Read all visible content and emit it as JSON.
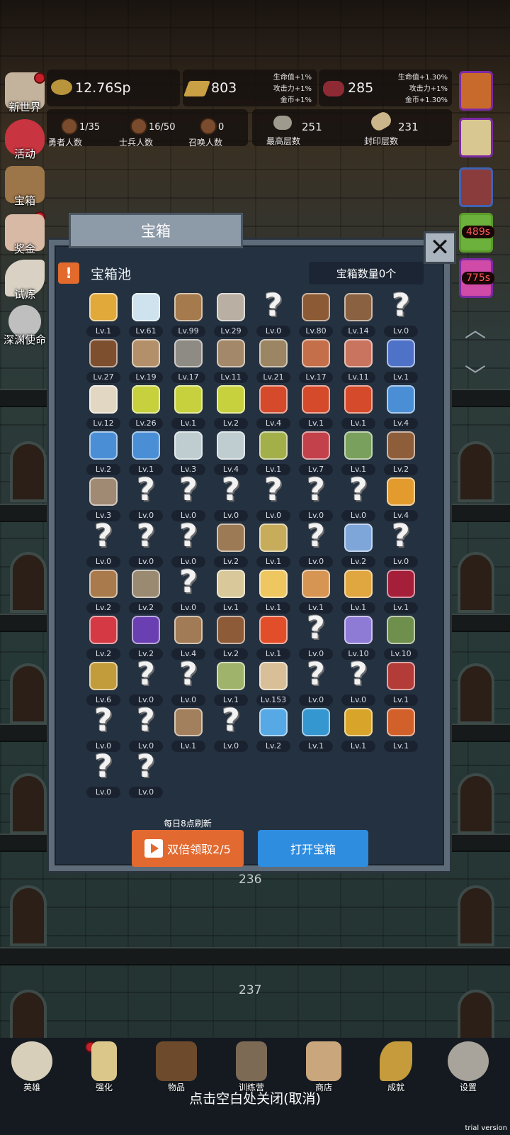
{
  "resources": {
    "coins": "12.76Sp",
    "gold_bar": "803",
    "gold_bar_bonus": [
      "生命值+1%",
      "攻击力+1%",
      "金币+1%"
    ],
    "meat": "285",
    "meat_bonus": [
      "生命值+1.30%",
      "攻击力+1%",
      "金币+1.30%"
    ]
  },
  "counts": {
    "heroes_value": "1/35",
    "heroes_label": "勇者人数",
    "soldiers_value": "16/50",
    "soldiers_label": "士兵人数",
    "summons_value": "0",
    "summons_label": "召唤人数",
    "max_floor_value": "251",
    "max_floor_label": "最高层数",
    "sealed_floor_value": "231",
    "sealed_floor_label": "封印层数"
  },
  "side_menu": [
    "新世界",
    "活动",
    "宝箱",
    "奖金",
    "试炼",
    "深渊使命"
  ],
  "timers": [
    "489s",
    "775s"
  ],
  "floors": [
    "236",
    "237"
  ],
  "modal": {
    "title": "宝箱",
    "pool_title": "宝箱池",
    "chest_count": "宝箱数量0个",
    "refresh_note": "每日8点刷新",
    "double_button": "双倍领取2/5",
    "open_button": "打开宝箱"
  },
  "items": [
    {
      "icon": "crown-icon",
      "level": "Lv.1"
    },
    {
      "icon": "diamond-icon",
      "level": "Lv.61"
    },
    {
      "icon": "wooden-sword-icon",
      "level": "Lv.99"
    },
    {
      "icon": "iron-sword-icon",
      "level": "Lv.29"
    },
    {
      "icon": "unknown-icon",
      "level": "Lv.0"
    },
    {
      "icon": "leather-armor-icon",
      "level": "Lv.80"
    },
    {
      "icon": "backpack-icon",
      "level": "Lv.14"
    },
    {
      "icon": "unknown-icon",
      "level": "Lv.0"
    },
    {
      "icon": "leather-helmet-icon",
      "level": "Lv.27"
    },
    {
      "icon": "dagger-icon",
      "level": "Lv.19"
    },
    {
      "icon": "knight-helmet-icon",
      "level": "Lv.17"
    },
    {
      "icon": "hammer-icon",
      "level": "Lv.11"
    },
    {
      "icon": "great-helm-icon",
      "level": "Lv.21"
    },
    {
      "icon": "drumstick-icon",
      "level": "Lv.17"
    },
    {
      "icon": "steak-icon",
      "level": "Lv.11"
    },
    {
      "icon": "blue-bag-icon",
      "level": "Lv.1"
    },
    {
      "icon": "flour-sack-icon",
      "level": "Lv.12"
    },
    {
      "icon": "yellow-potion-icon",
      "level": "Lv.26"
    },
    {
      "icon": "yellow-potion-icon",
      "level": "Lv.1"
    },
    {
      "icon": "yellow-potion-icon",
      "level": "Lv.2"
    },
    {
      "icon": "red-potion-icon",
      "level": "Lv.4"
    },
    {
      "icon": "red-potion-icon",
      "level": "Lv.1"
    },
    {
      "icon": "red-potion-icon",
      "level": "Lv.1"
    },
    {
      "icon": "blue-potion-icon",
      "level": "Lv.4"
    },
    {
      "icon": "blue-potion-icon",
      "level": "Lv.2"
    },
    {
      "icon": "blue-potion-icon",
      "level": "Lv.1"
    },
    {
      "icon": "empty-vial-icon",
      "level": "Lv.3"
    },
    {
      "icon": "empty-vial-icon",
      "level": "Lv.4"
    },
    {
      "icon": "green-bottle-icon",
      "level": "Lv.1"
    },
    {
      "icon": "red-bottle-icon",
      "level": "Lv.7"
    },
    {
      "icon": "winged-boot-icon",
      "level": "Lv.1"
    },
    {
      "icon": "boot-icon",
      "level": "Lv.2"
    },
    {
      "icon": "cloth-boot-icon",
      "level": "Lv.3"
    },
    {
      "icon": "unknown-icon",
      "level": "Lv.0"
    },
    {
      "icon": "unknown-icon",
      "level": "Lv.0"
    },
    {
      "icon": "unknown-icon",
      "level": "Lv.0"
    },
    {
      "icon": "unknown-icon",
      "level": "Lv.0"
    },
    {
      "icon": "unknown-icon",
      "level": "Lv.0"
    },
    {
      "icon": "unknown-icon",
      "level": "Lv.0"
    },
    {
      "icon": "torch-icon",
      "level": "Lv.4"
    },
    {
      "icon": "unknown-icon",
      "level": "Lv.0"
    },
    {
      "icon": "unknown-icon",
      "level": "Lv.0"
    },
    {
      "icon": "unknown-icon",
      "level": "Lv.0"
    },
    {
      "icon": "wooden-staff-icon",
      "level": "Lv.2"
    },
    {
      "icon": "potato-icon",
      "level": "Lv.1"
    },
    {
      "icon": "unknown-icon",
      "level": "Lv.0"
    },
    {
      "icon": "blue-wand-icon",
      "level": "Lv.2"
    },
    {
      "icon": "unknown-icon",
      "level": "Lv.0"
    },
    {
      "icon": "leather-bag-icon",
      "level": "Lv.2"
    },
    {
      "icon": "shovel-icon",
      "level": "Lv.2"
    },
    {
      "icon": "unknown-icon",
      "level": "Lv.0"
    },
    {
      "icon": "bone-club-icon",
      "level": "Lv.1"
    },
    {
      "icon": "cheese-icon",
      "level": "Lv.1"
    },
    {
      "icon": "pie-icon",
      "level": "Lv.1"
    },
    {
      "icon": "honey-jar-icon",
      "level": "Lv.1"
    },
    {
      "icon": "red-crystal-icon",
      "level": "Lv.1"
    },
    {
      "icon": "red-orb-icon",
      "level": "Lv.2"
    },
    {
      "icon": "magic-cube-icon",
      "level": "Lv.2"
    },
    {
      "icon": "bow-icon",
      "level": "Lv.4"
    },
    {
      "icon": "crossbow-icon",
      "level": "Lv.2"
    },
    {
      "icon": "fire-gauntlet-icon",
      "level": "Lv.1"
    },
    {
      "icon": "unknown-icon",
      "level": "Lv.0"
    },
    {
      "icon": "tentacle-icon",
      "level": "Lv.10"
    },
    {
      "icon": "rune-ring-icon",
      "level": "Lv.10"
    },
    {
      "icon": "golden-scepter-icon",
      "level": "Lv.6"
    },
    {
      "icon": "unknown-icon",
      "level": "Lv.0"
    },
    {
      "icon": "unknown-icon",
      "level": "Lv.0"
    },
    {
      "icon": "green-wand-icon",
      "level": "Lv.1"
    },
    {
      "icon": "beer-mug-icon",
      "level": "Lv.153"
    },
    {
      "icon": "unknown-icon",
      "level": "Lv.0"
    },
    {
      "icon": "unknown-icon",
      "level": "Lv.0"
    },
    {
      "icon": "spell-book-icon",
      "level": "Lv.1"
    },
    {
      "icon": "unknown-icon",
      "level": "Lv.0"
    },
    {
      "icon": "unknown-icon",
      "level": "Lv.0"
    },
    {
      "icon": "whip-icon",
      "level": "Lv.1"
    },
    {
      "icon": "unknown-icon",
      "level": "Lv.0"
    },
    {
      "icon": "blue-totem-icon",
      "level": "Lv.2"
    },
    {
      "icon": "blue-rune-disc-icon",
      "level": "Lv.1"
    },
    {
      "icon": "golden-orb-icon",
      "level": "Lv.1"
    },
    {
      "icon": "fire-arrow-icon",
      "level": "Lv.1"
    },
    {
      "icon": "unknown-icon",
      "level": "Lv.0"
    },
    {
      "icon": "unknown-icon",
      "level": "Lv.0"
    }
  ],
  "bottom_nav": [
    "英雄",
    "强化",
    "物品",
    "训练营",
    "商店",
    "成就",
    "设置"
  ],
  "close_hint": "点击空白处关闭(取消)",
  "watermark": "trial version",
  "colors": {
    "orange": "#e2692f",
    "blue": "#2f8de0",
    "panel": "#243140"
  }
}
